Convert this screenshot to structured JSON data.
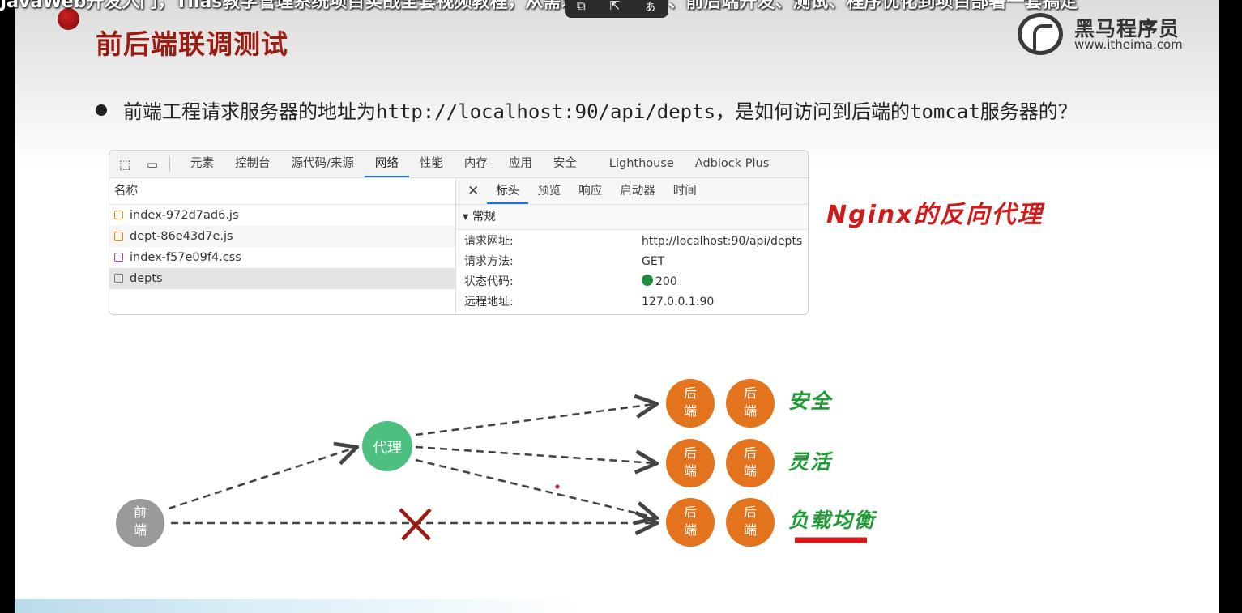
{
  "video": {
    "overlay_title": "JavaWeb开发入门，Tlias教学管理系统项目实战全套视频教程，从需求分析、设计、前后端开发、测试、程序优化到项目部署一套搞定",
    "toolbar_icons": [
      "picture-in-picture-icon",
      "share-icon",
      "translate-icon"
    ]
  },
  "slide": {
    "title": "前后端联调测试",
    "logo": {
      "cn": "黑马程序员",
      "url": "www.itheima.com"
    },
    "bullet": {
      "text_before": "前端工程请求服务器的地址为",
      "url": "http://localhost:90/api/depts",
      "text_after": "，是如何访问到后端的",
      "tomcat": "tomcat",
      "text_end": "服务器的？"
    },
    "annotation_main": "Nginx的反向代理"
  },
  "devtools": {
    "tabs": [
      "元素",
      "控制台",
      "源代码/来源",
      "网络",
      "性能",
      "内存",
      "应用",
      "安全",
      "Lighthouse",
      "Adblock Plus"
    ],
    "active_tab": "网络",
    "name_header": "名称",
    "files": [
      {
        "name": "index-972d7ad6.js",
        "type": "js"
      },
      {
        "name": "dept-86e43d7e.js",
        "type": "js"
      },
      {
        "name": "index-f57e09f4.css",
        "type": "css"
      },
      {
        "name": "depts",
        "type": "doc"
      }
    ],
    "subtabs": [
      "标头",
      "预览",
      "响应",
      "启动器",
      "时间"
    ],
    "active_subtab": "标头",
    "section_title": "▾ 常规",
    "general": [
      {
        "k": "请求网址:",
        "v": "http://localhost:90/api/depts"
      },
      {
        "k": "请求方法:",
        "v": "GET"
      },
      {
        "k": "状态代码:",
        "v": "200"
      },
      {
        "k": "远程地址:",
        "v": "127.0.0.1:90"
      }
    ]
  },
  "diagram": {
    "frontend": "前端",
    "proxy": "代理",
    "backend": "后端",
    "benefits": [
      "安全",
      "灵活",
      "负载均衡"
    ]
  },
  "colors": {
    "title_red": "#9a1d12",
    "proxy_green": "#4cc17f",
    "backend_orange": "#e3731c",
    "frontend_gray": "#9a9a9a",
    "cross_red": "#9b1c12",
    "benefit_green": "#1f9a35",
    "annotation_red": "#d01b1b"
  }
}
